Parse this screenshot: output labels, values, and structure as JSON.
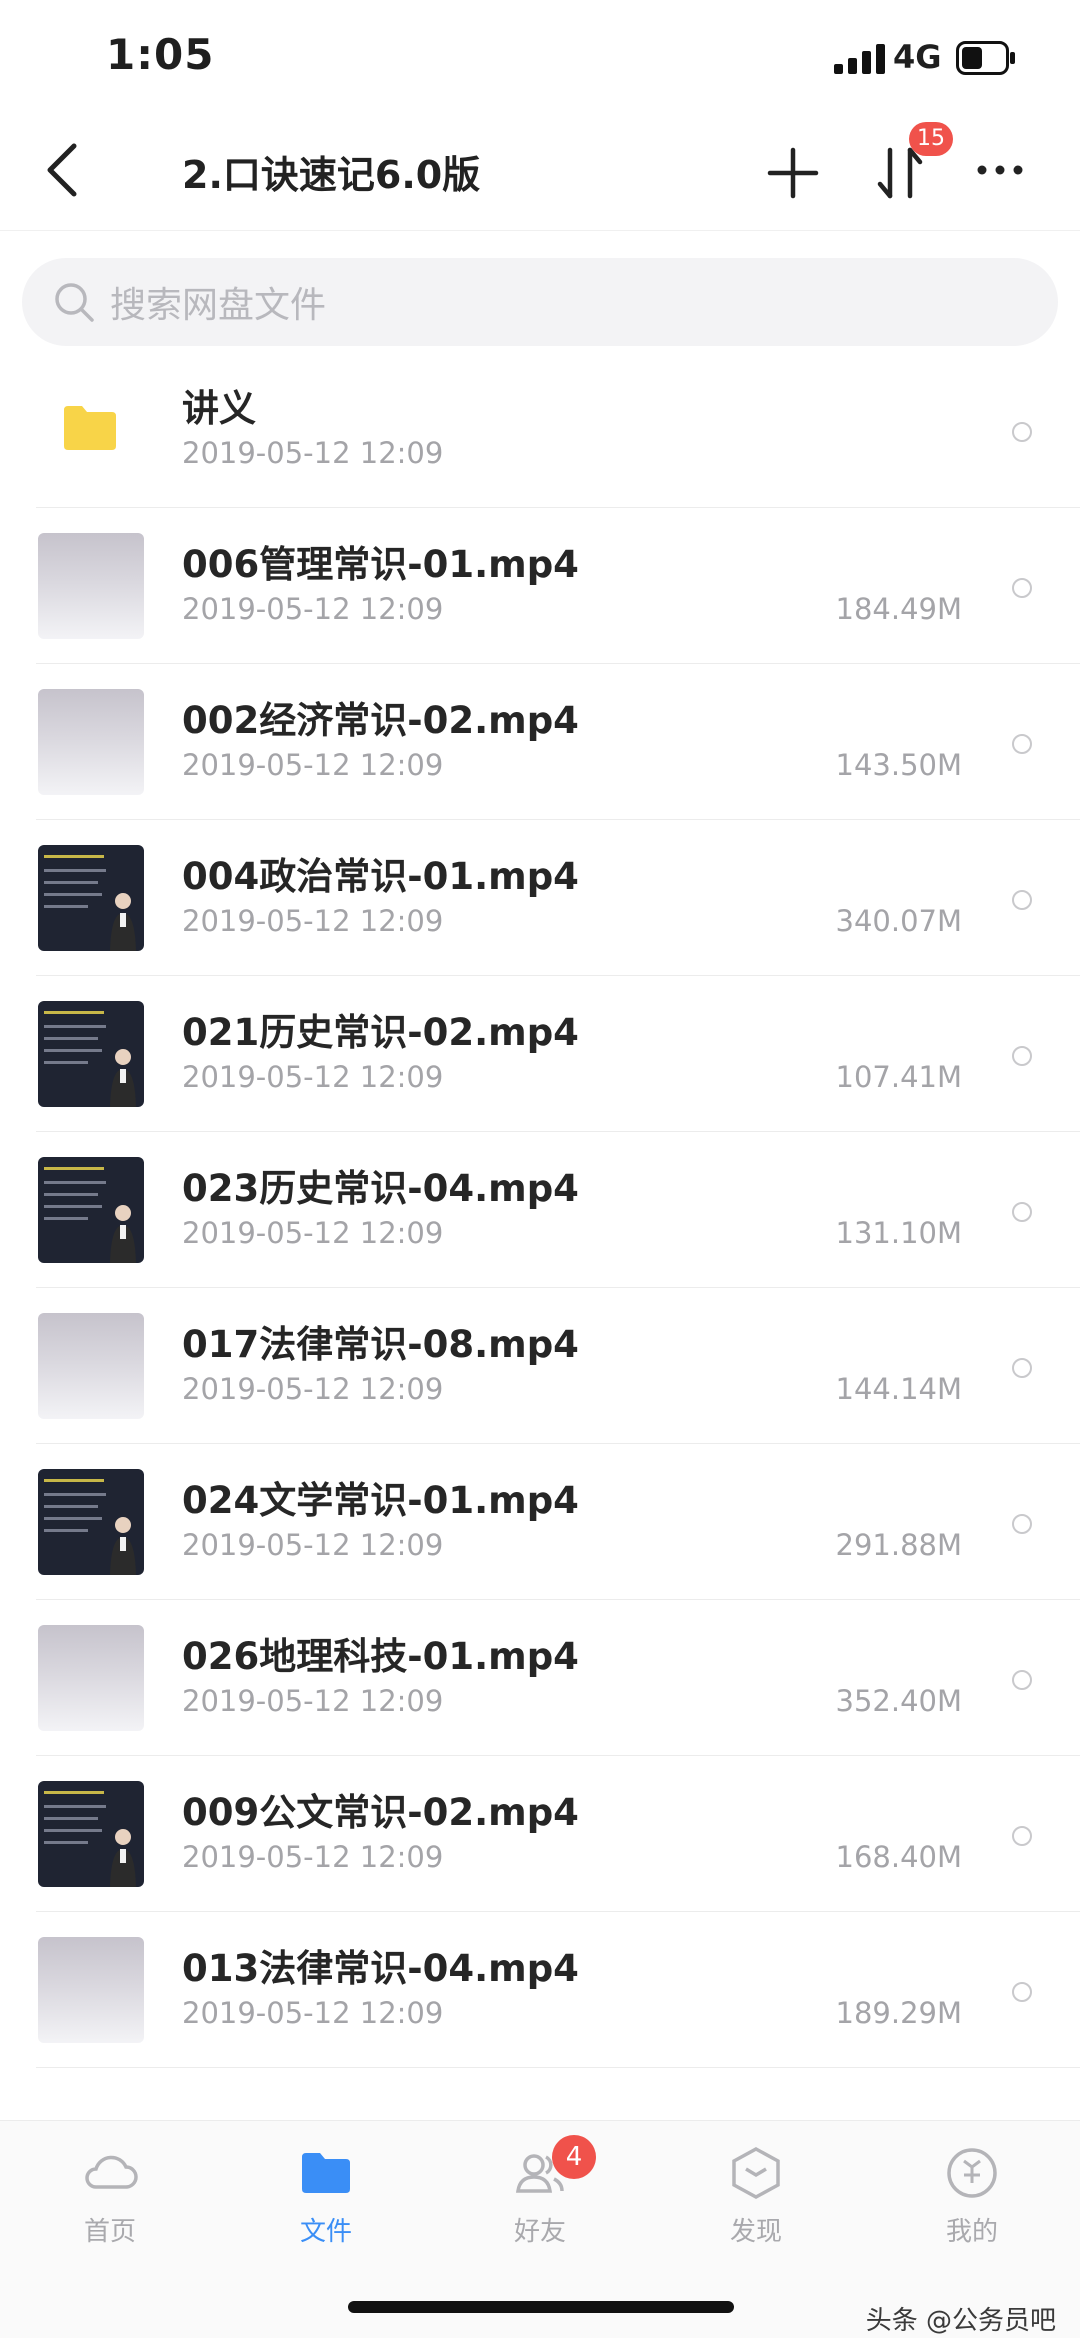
{
  "status": {
    "time": "1:05",
    "network": "4G"
  },
  "nav": {
    "title": "2.口诀速记6.0版",
    "transfer_badge": "15"
  },
  "search": {
    "placeholder": "搜索网盘文件"
  },
  "files": [
    {
      "name": "讲义",
      "date": "2019-05-12 12:09",
      "size": "",
      "thumb": "folder"
    },
    {
      "name": "006管理常识-01.mp4",
      "date": "2019-05-12 12:09",
      "size": "184.49M",
      "thumb": "gray"
    },
    {
      "name": "002经济常识-02.mp4",
      "date": "2019-05-12 12:09",
      "size": "143.50M",
      "thumb": "gray"
    },
    {
      "name": "004政治常识-01.mp4",
      "date": "2019-05-12 12:09",
      "size": "340.07M",
      "thumb": "dark"
    },
    {
      "name": "021历史常识-02.mp4",
      "date": "2019-05-12 12:09",
      "size": "107.41M",
      "thumb": "dark"
    },
    {
      "name": "023历史常识-04.mp4",
      "date": "2019-05-12 12:09",
      "size": "131.10M",
      "thumb": "dark"
    },
    {
      "name": "017法律常识-08.mp4",
      "date": "2019-05-12 12:09",
      "size": "144.14M",
      "thumb": "gray"
    },
    {
      "name": "024文学常识-01.mp4",
      "date": "2019-05-12 12:09",
      "size": "291.88M",
      "thumb": "dark"
    },
    {
      "name": "026地理科技-01.mp4",
      "date": "2019-05-12 12:09",
      "size": "352.40M",
      "thumb": "gray"
    },
    {
      "name": "009公文常识-02.mp4",
      "date": "2019-05-12 12:09",
      "size": "168.40M",
      "thumb": "dark"
    },
    {
      "name": "013法律常识-04.mp4",
      "date": "2019-05-12 12:09",
      "size": "189.29M",
      "thumb": "gray"
    }
  ],
  "tabs": [
    {
      "label": "首页",
      "icon": "cloud-icon",
      "active": false
    },
    {
      "label": "文件",
      "icon": "folder-icon",
      "active": true
    },
    {
      "label": "好友",
      "icon": "friends-icon",
      "active": false,
      "badge": "4"
    },
    {
      "label": "发现",
      "icon": "discover-icon",
      "active": false
    },
    {
      "label": "我的",
      "icon": "profile-icon",
      "active": false
    }
  ],
  "watermark": "头条 @公务员吧",
  "colors": {
    "accent": "#3a8ef6",
    "badge": "#f0524b",
    "folder": "#f8d448"
  }
}
